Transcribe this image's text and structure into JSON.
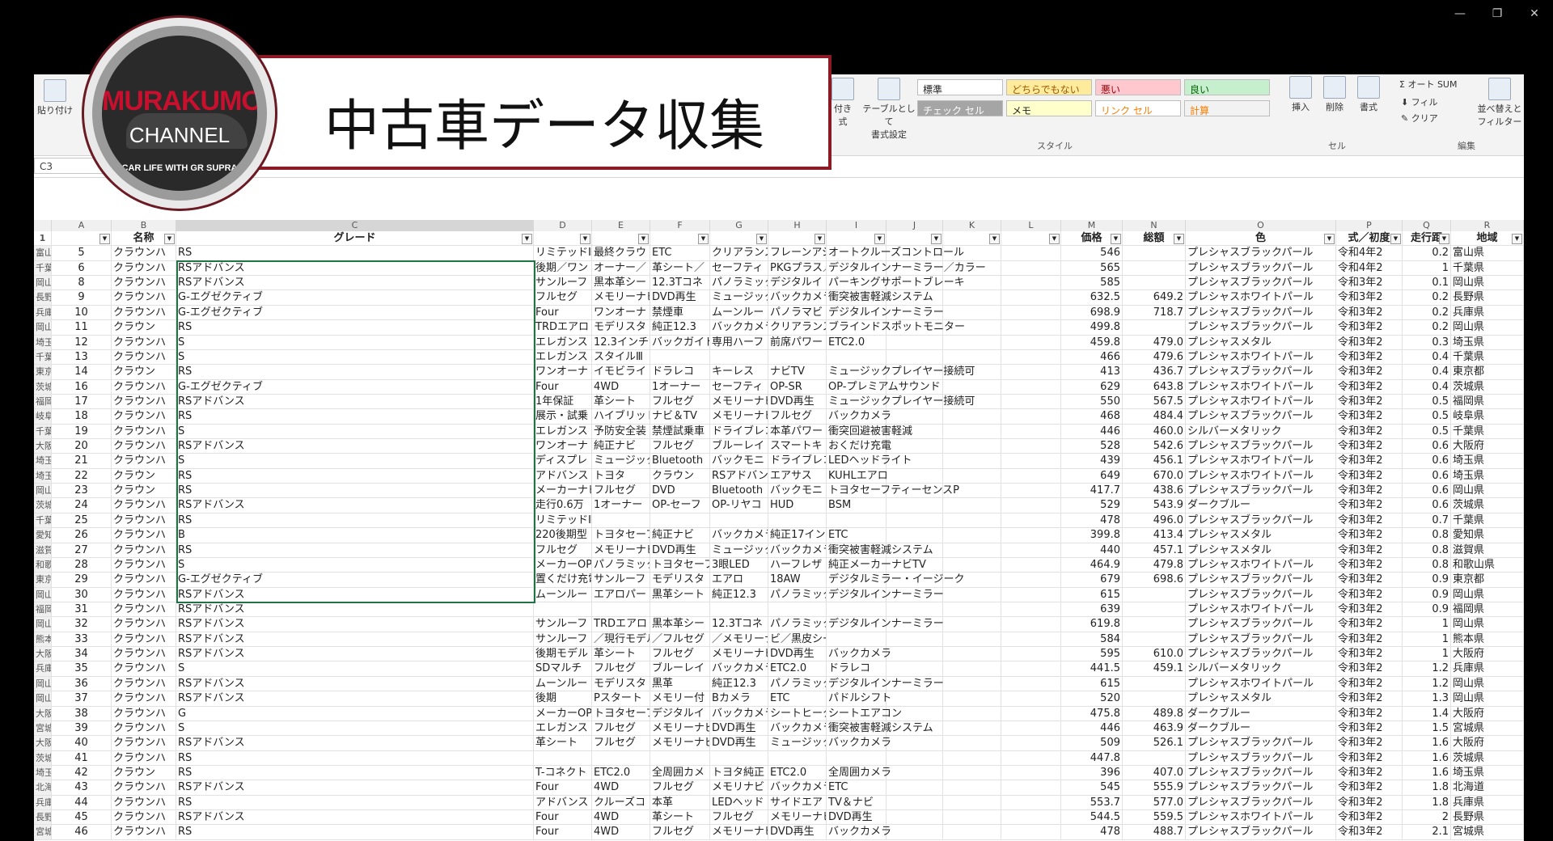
{
  "window": {
    "minimize": "—",
    "restore": "❐",
    "close": "✕"
  },
  "overlay": {
    "logo_name": "MURAKUMO",
    "logo_channel": "CHANNEL",
    "logo_tag": "CAR LIFE WITH GR SUPRA",
    "title": "中古車データ収集"
  },
  "ribbon": {
    "paste": "貼り付け",
    "cond_format": "付き",
    "cond_format2": "式",
    "table_format": "テーブルとして",
    "table_format2": "書式設定",
    "styles": [
      {
        "label": "標準",
        "bg": "#ffffff",
        "fg": "#222222"
      },
      {
        "label": "どちらでもない",
        "bg": "#ffeb9c",
        "fg": "#9c5700"
      },
      {
        "label": "悪い",
        "bg": "#ffc7ce",
        "fg": "#9c0006"
      },
      {
        "label": "良い",
        "bg": "#c6efce",
        "fg": "#006100"
      },
      {
        "label": "チェック セル",
        "bg": "#a5a5a5",
        "fg": "#ffffff"
      },
      {
        "label": "メモ",
        "bg": "#ffffcc",
        "fg": "#222222"
      },
      {
        "label": "リンク セル",
        "bg": "#ffffff",
        "fg": "#fa7d00"
      },
      {
        "label": "計算",
        "bg": "#f2f2f2",
        "fg": "#fa7d00"
      }
    ],
    "style_group": "スタイル",
    "insert": "挿入",
    "delete": "削除",
    "format": "書式",
    "cell_group": "セル",
    "autosum": "Σ オート SUM",
    "fill": "フィル",
    "clear": "クリア",
    "sort": "並べ替えと",
    "sort2": "フィルター",
    "edit_group": "編集"
  },
  "namebox": "C3",
  "columns": [
    "A",
    "B",
    "C",
    "D",
    "E",
    "F",
    "G",
    "H",
    "I",
    "J",
    "K",
    "L",
    "M",
    "N",
    "O",
    "P",
    "Q",
    "R"
  ],
  "headers": {
    "A": "",
    "B": "名称",
    "C": "グレード",
    "M": "価格",
    "N": "総額",
    "O": "色",
    "P": "式／初度",
    "Q": "走行距",
    "R": "地域"
  },
  "rows": [
    {
      "r": "富山県",
      "a": "5",
      "b": "クラウンハ",
      "c": "RS",
      "d": "リミテッドⅡ",
      "e": "最終クラウ",
      "f": "ETC",
      "g": "クリアランス",
      "h": "フレーンアシ",
      "i": "オートクルーズコントロール",
      "m": "546",
      "n": "",
      "o": "プレシャスブラックパール",
      "p": "令和4年2",
      "q": "0.2"
    },
    {
      "r": "千葉県",
      "a": "6",
      "b": "クラウンハ",
      "c": "RSアドバンス",
      "d": "後期／ワン",
      "e": "オーナー／",
      "f": "革シート／",
      "g": "セーフティ",
      "h": "PKGプラス／",
      "i": "デジタルインナーミラー／カラー",
      "m": "565",
      "n": "",
      "o": "プレシャスブラックパール",
      "p": "令和4年2",
      "q": "1"
    },
    {
      "r": "岡山県",
      "a": "8",
      "b": "クラウンハ",
      "c": "RSアドバンス",
      "d": "サンルーフ",
      "e": "黒本革シー",
      "f": "12.3Tコネ",
      "g": "パノラミック",
      "h": "デジタルイ",
      "i": "パーキングサポートブレーキ",
      "m": "585",
      "n": "",
      "o": "プレシャスブラックパール",
      "p": "令和3年2",
      "q": "0.1"
    },
    {
      "r": "長野県",
      "a": "9",
      "b": "クラウンハ",
      "c": "G-エグゼクティブ",
      "d": "フルセグ",
      "e": "メモリーナビ",
      "f": "DVD再生",
      "g": "ミュージック",
      "h": "バックカメラ",
      "i": "衝突被害軽減システム",
      "m": "632.5",
      "n": "649.2",
      "o": "プレシャスホワイトパール",
      "p": "令和3年2",
      "q": "0.2"
    },
    {
      "r": "兵庫県",
      "a": "10",
      "b": "クラウンハ",
      "c": "G-エグゼクティブ",
      "d": "Four",
      "e": "ワンオーナ",
      "f": "禁煙車",
      "g": "ムーンルー",
      "h": "パノラマビ",
      "i": "デジタルインナーミラー",
      "m": "698.9",
      "n": "718.7",
      "o": "プレシャスブラックパール",
      "p": "令和3年2",
      "q": "0.2"
    },
    {
      "r": "岡山県",
      "a": "11",
      "b": "クラウン",
      "c": "RS",
      "d": "TRDエアロ",
      "e": "モデリスタ",
      "f": "純正12.3",
      "g": "バックカメラ",
      "h": "クリアランス",
      "i": "ブラインドスポットモニター",
      "m": "499.8",
      "n": "",
      "o": "プレシャスブラックパール",
      "p": "令和3年2",
      "q": "0.2"
    },
    {
      "r": "埼玉県",
      "a": "12",
      "b": "クラウンハ",
      "c": "S",
      "d": "エレガンス",
      "e": "12.3インチ",
      "f": "バックガイド",
      "g": "専用ハーフ",
      "h": "前席パワー",
      "i": "ETC2.0",
      "m": "459.8",
      "n": "479.0",
      "o": "プレシャスメタル",
      "p": "令和3年2",
      "q": "0.3"
    },
    {
      "r": "千葉県",
      "a": "13",
      "b": "クラウンハ",
      "c": "S",
      "d": "エレガンス",
      "e": "スタイルⅢ",
      "f": "",
      "g": "",
      "h": "",
      "i": "",
      "m": "466",
      "n": "479.6",
      "o": "プレシャスホワイトパール",
      "p": "令和3年2",
      "q": "0.4"
    },
    {
      "r": "東京都",
      "a": "14",
      "b": "クラウン",
      "c": "RS",
      "d": "ワンオーナ",
      "e": "イモビライ",
      "f": "ドラレコ",
      "g": "キーレス",
      "h": "ナビTV",
      "i": "ミュージックプレイヤー接続可",
      "m": "413",
      "n": "436.7",
      "o": "プレシャスブラックパール",
      "p": "令和3年2",
      "q": "0.4"
    },
    {
      "r": "茨城県",
      "a": "16",
      "b": "クラウンハ",
      "c": "G-エグゼクティブ",
      "d": "Four",
      "e": "4WD",
      "f": "1オーナー",
      "g": "セーフティ",
      "h": "OP-SR",
      "i": "OP-プレミアムサウンド",
      "m": "629",
      "n": "643.8",
      "o": "プレシャスホワイトパール",
      "p": "令和3年2",
      "q": "0.4"
    },
    {
      "r": "福岡県",
      "a": "17",
      "b": "クラウンハ",
      "c": "RSアドバンス",
      "d": "1年保証",
      "e": "革シート",
      "f": "フルセグ",
      "g": "メモリーナビ",
      "h": "DVD再生",
      "i": "ミュージックプレイヤー接続可",
      "m": "550",
      "n": "567.5",
      "o": "プレシャスホワイトパール",
      "p": "令和3年2",
      "q": "0.5"
    },
    {
      "r": "岐阜県",
      "a": "18",
      "b": "クラウンハ",
      "c": "RS",
      "d": "展示・試乗",
      "e": "ハイブリッド",
      "f": "ナビ＆TV",
      "g": "メモリーナビ",
      "h": "フルセグ",
      "i": "バックカメラ",
      "m": "468",
      "n": "484.4",
      "o": "プレシャスブラックパール",
      "p": "令和3年2",
      "q": "0.5"
    },
    {
      "r": "千葉県",
      "a": "19",
      "b": "クラウンハ",
      "c": "S",
      "d": "エレガンス",
      "e": "予防安全装",
      "f": "禁煙試乗車",
      "g": "ドライブレコ",
      "h": "本革パワー",
      "i": "衝突回避被害軽減",
      "m": "446",
      "n": "460.0",
      "o": "シルバーメタリック",
      "p": "令和3年2",
      "q": "0.5"
    },
    {
      "r": "大阪府",
      "a": "20",
      "b": "クラウンハ",
      "c": "RSアドバンス",
      "d": "ワンオーナ",
      "e": "純正ナビ",
      "f": "フルセグ",
      "g": "ブルーレイ",
      "h": "スマートキ",
      "i": "おくだけ充電",
      "m": "528",
      "n": "542.6",
      "o": "プレシャスブラックパール",
      "p": "令和3年2",
      "q": "0.6"
    },
    {
      "r": "埼玉県",
      "a": "21",
      "b": "クラウンハ",
      "c": "S",
      "d": "ディスプレ",
      "e": "ミュージック",
      "f": "Bluetooth",
      "g": "バックモニ",
      "h": "ドライブレコ",
      "i": "LEDヘッドライト",
      "m": "439",
      "n": "456.1",
      "o": "プレシャスホワイトパール",
      "p": "令和3年2",
      "q": "0.6"
    },
    {
      "r": "埼玉県",
      "a": "22",
      "b": "クラウン",
      "c": "RS",
      "d": "アドバンス",
      "e": "トヨタ",
      "f": "クラウン",
      "g": "RSアドバン",
      "h": "エアサス",
      "i": "KUHLエアロ",
      "m": "649",
      "n": "670.0",
      "o": "プレシャスホワイトパール",
      "p": "令和3年2",
      "q": "0.6"
    },
    {
      "r": "岡山県",
      "a": "23",
      "b": "クラウン",
      "c": "RS",
      "d": "メーカーナビ",
      "e": "フルセグ",
      "f": "DVD",
      "g": "Bluetooth",
      "h": "バックモニ",
      "i": "トヨタセーフティーセンスP",
      "m": "417.7",
      "n": "438.6",
      "o": "プレシャスブラックパール",
      "p": "令和3年2",
      "q": "0.6"
    },
    {
      "r": "茨城県",
      "a": "24",
      "b": "クラウンハ",
      "c": "RSアドバンス",
      "d": "走行0.6万",
      "e": "1オーナー",
      "f": "OP-セーフ",
      "g": "OP-リヤコ",
      "h": "HUD",
      "i": "BSM",
      "m": "529",
      "n": "543.9",
      "o": "ダークブルー",
      "p": "令和3年2",
      "q": "0.6"
    },
    {
      "r": "千葉県",
      "a": "25",
      "b": "クラウンハ",
      "c": "RS",
      "d": "リミテッドⅡ",
      "e": "",
      "f": "",
      "g": "",
      "h": "",
      "i": "",
      "m": "478",
      "n": "496.0",
      "o": "プレシャスブラックパール",
      "p": "令和3年2",
      "q": "0.7"
    },
    {
      "r": "愛知県",
      "a": "26",
      "b": "クラウンハ",
      "c": "B",
      "d": "220後期型",
      "e": "トヨタセーフ",
      "f": "純正ナビ",
      "g": "バックカメラ",
      "h": "純正17イン",
      "i": "ETC",
      "m": "399.8",
      "n": "413.4",
      "o": "プレシャスメタル",
      "p": "令和3年2",
      "q": "0.8"
    },
    {
      "r": "滋賀県",
      "a": "27",
      "b": "クラウンハ",
      "c": "RS",
      "d": "フルセグ",
      "e": "メモリーナビ",
      "f": "DVD再生",
      "g": "ミュージック",
      "h": "バックカメラ",
      "i": "衝突被害軽減システム",
      "m": "440",
      "n": "457.1",
      "o": "プレシャスメタル",
      "p": "令和3年2",
      "q": "0.8"
    },
    {
      "r": "和歌山県",
      "a": "28",
      "b": "クラウンハ",
      "c": "S",
      "d": "メーカーOP",
      "e": "パノラミック",
      "f": "トヨタセーフ",
      "g": "3眼LED",
      "h": "ハーフレザ",
      "i": "純正メーカーナビTV",
      "m": "464.9",
      "n": "479.8",
      "o": "プレシャスホワイトパール",
      "p": "令和3年2",
      "q": "0.8"
    },
    {
      "r": "東京都",
      "a": "29",
      "b": "クラウンハ",
      "c": "G-エグゼクティブ",
      "d": "置くだけ充電",
      "e": "サンルーフ",
      "f": "モデリスタ",
      "g": "エアロ",
      "h": "18AW",
      "i": "デジタルミラー・イージーク",
      "m": "679",
      "n": "698.6",
      "o": "プレシャスブラックパール",
      "p": "令和3年2",
      "q": "0.9"
    },
    {
      "r": "岡山県",
      "a": "30",
      "b": "クラウンハ",
      "c": "RSアドバンス",
      "d": "ムーンルー",
      "e": "エアロパー",
      "f": "黒革シート",
      "g": "純正12.3",
      "h": "パノラミック",
      "i": "デジタルインナーミラー",
      "m": "615",
      "n": "",
      "o": "プレシャスブラックパール",
      "p": "令和3年2",
      "q": "0.9"
    },
    {
      "r": "福岡県",
      "a": "31",
      "b": "クラウンハ",
      "c": "RSアドバンス",
      "d": "",
      "e": "",
      "f": "",
      "g": "",
      "h": "",
      "i": "",
      "m": "639",
      "n": "",
      "o": "プレシャスホワイトパール",
      "p": "令和3年2",
      "q": "0.9"
    },
    {
      "r": "岡山県",
      "a": "32",
      "b": "クラウンハ",
      "c": "RSアドバンス",
      "d": "サンルーフ",
      "e": "TRDエアロ",
      "f": "黒本革シー",
      "g": "12.3Tコネ",
      "h": "パノラミック",
      "i": "デジタルインナーミラー",
      "m": "619.8",
      "n": "",
      "o": "プレシャスブラックパール",
      "p": "令和3年2",
      "q": "1"
    },
    {
      "r": "熊本県",
      "a": "33",
      "b": "クラウンハ",
      "c": "RSアドバンス",
      "d": "サンルーフ",
      "e": "／現行モデル",
      "f": "／フルセグ",
      "g": "／メモリーナ",
      "h": "ビ／黒皮シート",
      "i": "",
      "m": "584",
      "n": "",
      "o": "プレシャスブラックパール",
      "p": "令和3年2",
      "q": "1"
    },
    {
      "r": "大阪府",
      "a": "34",
      "b": "クラウンハ",
      "c": "RSアドバンス",
      "d": "後期モデル",
      "e": "革シート",
      "f": "フルセグ",
      "g": "メモリーナビ",
      "h": "DVD再生",
      "i": "バックカメラ",
      "m": "595",
      "n": "610.0",
      "o": "プレシャスブラックパール",
      "p": "令和3年2",
      "q": "1"
    },
    {
      "r": "兵庫県",
      "a": "35",
      "b": "クラウンハ",
      "c": "S",
      "d": "SDマルチ",
      "e": "フルセグ",
      "f": "ブルーレイ",
      "g": "バックカメラ",
      "h": "ETC2.0",
      "i": "ドラレコ",
      "m": "441.5",
      "n": "459.1",
      "o": "シルバーメタリック",
      "p": "令和3年2",
      "q": "1.2"
    },
    {
      "r": "岡山県",
      "a": "36",
      "b": "クラウンハ",
      "c": "RSアドバンス",
      "d": "ムーンルー",
      "e": "モデリスタ",
      "f": "黒革",
      "g": "純正12.3",
      "h": "パノラミック",
      "i": "デジタルインナーミラー",
      "m": "615",
      "n": "",
      "o": "プレシャスホワイトパール",
      "p": "令和3年2",
      "q": "1.2"
    },
    {
      "r": "岡山県",
      "a": "37",
      "b": "クラウンハ",
      "c": "RSアドバンス",
      "d": "後期",
      "e": "Pスタート",
      "f": "メモリー付",
      "g": "Bカメラ",
      "h": "ETC",
      "i": "パドルシフト",
      "m": "520",
      "n": "",
      "o": "プレシャスメタル",
      "p": "令和3年2",
      "q": "1.3"
    },
    {
      "r": "大阪府",
      "a": "38",
      "b": "クラウンハ",
      "c": "G",
      "d": "メーカーOP",
      "e": "トヨタセーフ",
      "f": "デジタルイ",
      "g": "バックカメラ",
      "h": "シートヒータ",
      "i": "シートエアコン",
      "m": "475.8",
      "n": "489.8",
      "o": "ダークブルー",
      "p": "令和3年2",
      "q": "1.4"
    },
    {
      "r": "宮城県",
      "a": "39",
      "b": "クラウンハ",
      "c": "S",
      "d": "エレガンス",
      "e": "フルセグ",
      "f": "メモリーナビ",
      "g": "DVD再生",
      "h": "バックカメラ",
      "i": "衝突被害軽減システム",
      "m": "446",
      "n": "463.9",
      "o": "ダークブルー",
      "p": "令和3年2",
      "q": "1.5"
    },
    {
      "r": "大阪府",
      "a": "40",
      "b": "クラウンハ",
      "c": "RSアドバンス",
      "d": "革シート",
      "e": "フルセグ",
      "f": "メモリーナビ",
      "g": "DVD再生",
      "h": "ミュージック",
      "i": "バックカメラ",
      "m": "509",
      "n": "526.1",
      "o": "プレシャスブラックパール",
      "p": "令和3年2",
      "q": "1.6"
    },
    {
      "r": "茨城県",
      "a": "41",
      "b": "クラウンハ",
      "c": "RS",
      "d": "",
      "e": "",
      "f": "",
      "g": "",
      "h": "",
      "i": "",
      "m": "447.8",
      "n": "",
      "o": "プレシャスブラックパール",
      "p": "令和3年2",
      "q": "1.6"
    },
    {
      "r": "埼玉県",
      "a": "42",
      "b": "クラウン",
      "c": "RS",
      "d": "T-コネクト",
      "e": "ETC2.0",
      "f": "全周囲カメ",
      "g": "トヨタ純正",
      "h": "ETC2.0",
      "i": "全周囲カメラ",
      "m": "396",
      "n": "407.0",
      "o": "プレシャスブラックパール",
      "p": "令和3年2",
      "q": "1.6"
    },
    {
      "r": "北海道",
      "a": "43",
      "b": "クラウンハ",
      "c": "RSアドバンス",
      "d": "Four",
      "e": "4WD",
      "f": "フルセグ",
      "g": "メモリナビ",
      "h": "バックカメラ",
      "i": "ETC",
      "m": "545",
      "n": "555.9",
      "o": "プレシャスブラックパール",
      "p": "令和3年2",
      "q": "1.8"
    },
    {
      "r": "兵庫県",
      "a": "44",
      "b": "クラウンハ",
      "c": "RS",
      "d": "アドバンス",
      "e": "クルーズコ",
      "f": "本革",
      "g": "LEDヘッド",
      "h": "サイドエア",
      "i": "TV＆ナビ",
      "m": "553.7",
      "n": "577.0",
      "o": "プレシャスブラックパール",
      "p": "令和3年2",
      "q": "1.8"
    },
    {
      "r": "長野県",
      "a": "45",
      "b": "クラウンハ",
      "c": "RSアドバンス",
      "d": "Four",
      "e": "4WD",
      "f": "革シート",
      "g": "フルセグ",
      "h": "メモリーナビ",
      "i": "DVD再生",
      "m": "544.5",
      "n": "559.5",
      "o": "プレシャスホワイトパール",
      "p": "令和3年2",
      "q": "2"
    },
    {
      "r": "宮城県",
      "a": "46",
      "b": "クラウンハ",
      "c": "RS",
      "d": "Four",
      "e": "4WD",
      "f": "フルセグ",
      "g": "メモリーナビ",
      "h": "DVD再生",
      "i": "バックカメラ",
      "m": "478",
      "n": "488.7",
      "o": "プレシャスブラックパール",
      "p": "令和3年2",
      "q": "2.1"
    }
  ]
}
